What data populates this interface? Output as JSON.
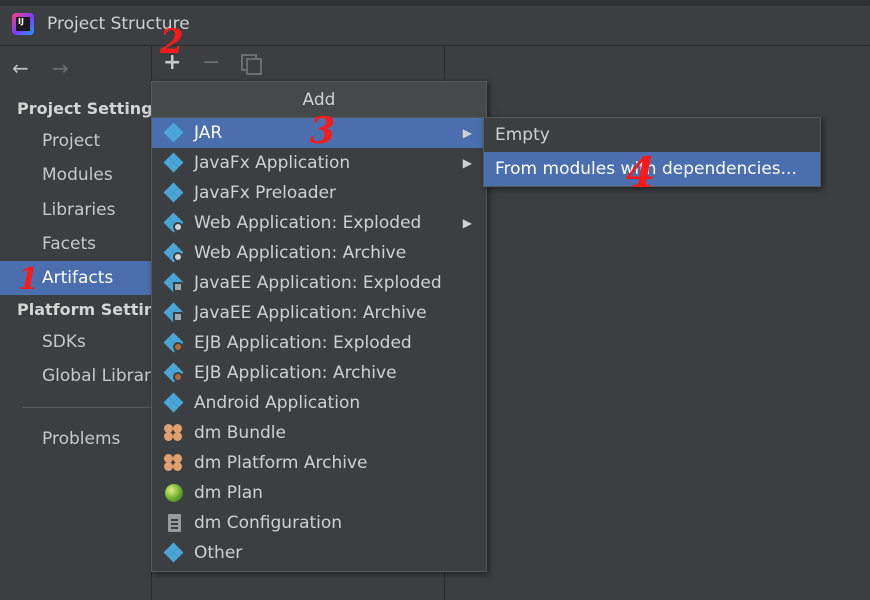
{
  "window": {
    "title": "Project Structure"
  },
  "toolbar": {
    "back_icon": "←",
    "forward_icon": "→",
    "add_icon": "+",
    "remove_icon": "−"
  },
  "sidebar": {
    "sections": [
      {
        "header": "Project Setting",
        "items": [
          "Project",
          "Modules",
          "Libraries",
          "Facets",
          "Artifacts"
        ]
      },
      {
        "header": "Platform Settin",
        "items": [
          "SDKs",
          "Global Librar"
        ]
      }
    ],
    "extra_items": [
      "Problems"
    ],
    "selected": "Artifacts"
  },
  "menu": {
    "header": "Add",
    "items": [
      {
        "label": "JAR",
        "icon": "artifact-icon",
        "submenu": true
      },
      {
        "label": "JavaFx Application",
        "icon": "artifact-icon",
        "submenu": true
      },
      {
        "label": "JavaFx Preloader",
        "icon": "artifact-icon",
        "submenu": false
      },
      {
        "label": "Web Application: Exploded",
        "icon": "web-artifact-icon",
        "submenu": true
      },
      {
        "label": "Web Application: Archive",
        "icon": "web-artifact-icon",
        "submenu": false
      },
      {
        "label": "JavaEE Application: Exploded",
        "icon": "javaee-artifact-icon",
        "submenu": false
      },
      {
        "label": "JavaEE Application: Archive",
        "icon": "javaee-artifact-icon",
        "submenu": false
      },
      {
        "label": "EJB Application: Exploded",
        "icon": "ejb-artifact-icon",
        "submenu": false
      },
      {
        "label": "EJB Application: Archive",
        "icon": "ejb-artifact-icon",
        "submenu": false
      },
      {
        "label": "Android Application",
        "icon": "artifact-icon",
        "submenu": false
      },
      {
        "label": "dm Bundle",
        "icon": "bundle-icon",
        "submenu": false
      },
      {
        "label": "dm Platform Archive",
        "icon": "bundle-icon",
        "submenu": false
      },
      {
        "label": "dm Plan",
        "icon": "plan-globe-icon",
        "submenu": false
      },
      {
        "label": "dm Configuration",
        "icon": "document-icon",
        "submenu": false
      },
      {
        "label": "Other",
        "icon": "artifact-icon",
        "submenu": false
      }
    ],
    "highlighted": "JAR",
    "submenu_arrow": "▶"
  },
  "submenu": {
    "items": [
      "Empty",
      "From modules with dependencies..."
    ],
    "highlighted": "From modules with dependencies..."
  },
  "annotations": [
    "1",
    "2",
    "3",
    "4"
  ],
  "colors": {
    "background": "#3c3f41",
    "selection": "#4b6eaf",
    "text": "#d0d0d0",
    "annotation": "#ff1a1a",
    "artifact_icon": "#49a6d8"
  }
}
